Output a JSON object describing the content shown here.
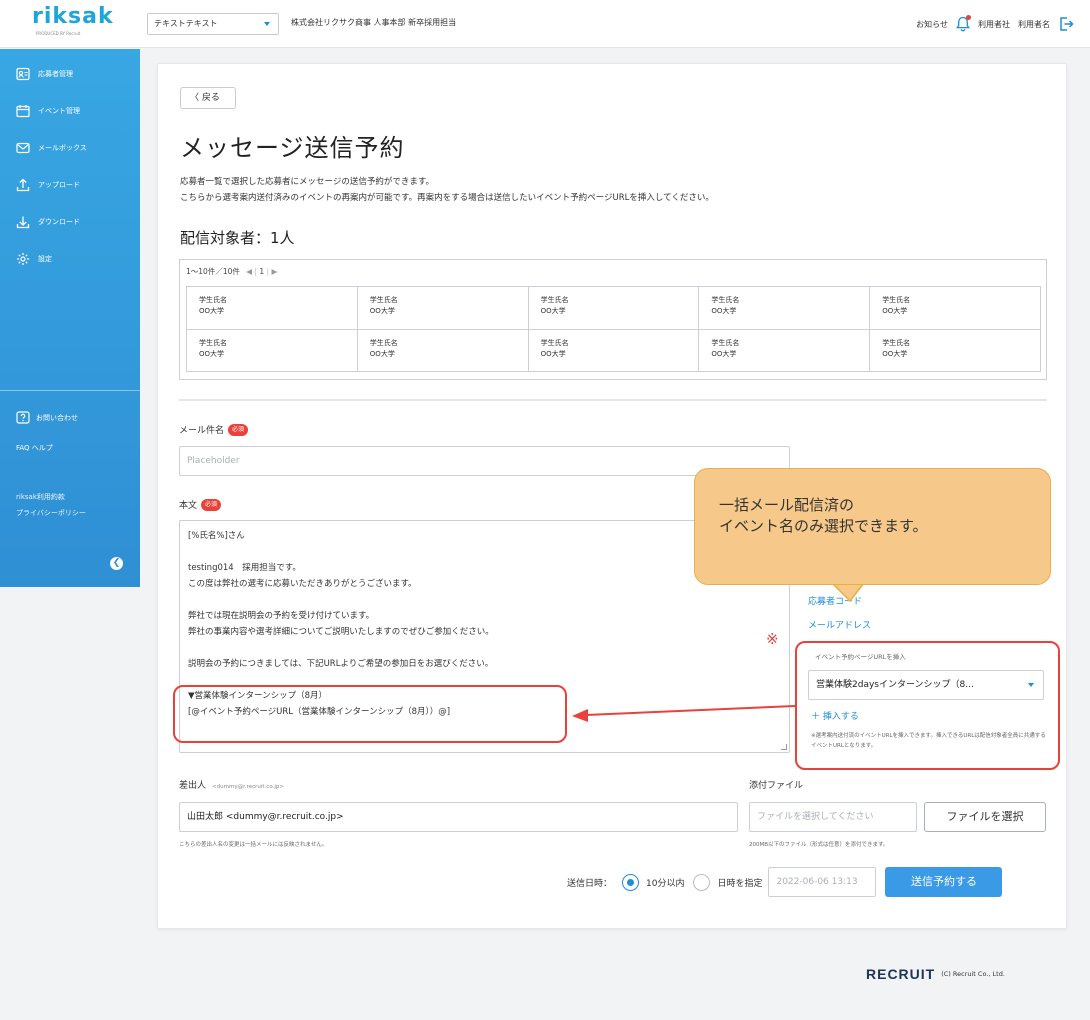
{
  "header": {
    "logo": "riksak",
    "logo_sub": "PRODUCED BY Recruit",
    "tenant": "テキストテキスト",
    "company": "株式会社リクサク商事 人事本部 新卒採用担当",
    "notice": "お知らせ",
    "company_user": "利用者社",
    "user": "利用者名"
  },
  "sidebar": {
    "items": [
      {
        "label": "応募者管理",
        "icon": "applicant-icon"
      },
      {
        "label": "イベント管理",
        "icon": "calendar-icon"
      },
      {
        "label": "メールボックス",
        "icon": "mail-icon"
      },
      {
        "label": "アップロード",
        "icon": "upload-icon"
      },
      {
        "label": "ダウンロード",
        "icon": "download-icon"
      },
      {
        "label": "設定",
        "icon": "gear-icon"
      }
    ],
    "contact": "お問い合わせ",
    "faq": "FAQ ヘルプ",
    "terms": "riksak利用約款",
    "privacy": "プライバシーポリシー"
  },
  "main": {
    "back": "戻る",
    "title": "メッセージ送信予約",
    "desc1": "応募者一覧で選択した応募者にメッセージの送信予約ができます。",
    "desc2": "こちらから選考案内送付済みのイベントの再案内が可能です。再案内をする場合は送信したいイベント予約ページURLを挿入してください。",
    "recipients": "配信対象者：1人",
    "pager": "1〜10件／10件",
    "pager_page": "1",
    "rows": [
      [
        [
          "学生氏名",
          "OO大学"
        ],
        [
          "学生氏名",
          "OO大学"
        ],
        [
          "学生氏名",
          "OO大学"
        ],
        [
          "学生氏名",
          "OO大学"
        ],
        [
          "学生氏名",
          "OO大学"
        ]
      ],
      [
        [
          "学生氏名",
          "OO大学"
        ],
        [
          "学生氏名",
          "OO大学"
        ],
        [
          "学生氏名",
          "OO大学"
        ],
        [
          "学生氏名",
          "OO大学"
        ],
        [
          "学生氏名",
          "OO大学"
        ]
      ]
    ],
    "subject_label": "メール件名",
    "required": "必須",
    "subject_placeholder": "Placeholder",
    "body_label": "本文",
    "body_lines": [
      "[%氏名%]さん",
      "",
      "testing014　採用担当です。",
      "この度は弊社の選考に応募いただきありがとうございます。",
      "",
      "弊社では現在説明会の予約を受け付けています。",
      "弊社の事業内容や選考詳細についてご説明いたしますのでぜひご参加ください。",
      "",
      "説明会の予約につきましては、下記URLよりご希望の参加日をお選びください。",
      "",
      "▼営業体験インターンシップ（8月）",
      "[@イベント予約ページURL（営業体験インターンシップ（8月））@]"
    ],
    "insert_code": "応募者コード",
    "insert_mail": "メールアドレス",
    "kome": "※",
    "event_url_label": "イベント予約ページURLを挿入",
    "event_selected": "営業体験2daysインターンシップ（8...",
    "insert_btn": "＋ 挿入する",
    "event_note": "※選考案内送付済のイベントURLを挿入できます。挿入できるURLは配信対象者全員に共通するイベントURLとなります。",
    "callout1": "一括メール配信済の",
    "callout2": "イベント名のみ選択できます。",
    "sender_label": "差出人",
    "sender_email": "<dummy@r.recruit.co.jp>",
    "sender_value": "山田太郎 <dummy@r.recruit.co.jp>",
    "sender_note": "こちらの差出人名の変更は一括メールには反映されません。",
    "attach_label": "添付ファイル",
    "attach_placeholder": "ファイルを選択してください",
    "attach_btn": "ファイルを選択",
    "attach_note": "200MB以下のファイル（形式は任意）を添付できます。",
    "send_time_label": "送信日時：",
    "opt1": "10分以内",
    "opt2": "日時を指定",
    "datetime": "2022-06-06 13:13",
    "send_btn": "送信予約する"
  },
  "footer": {
    "logo": "RECRUIT",
    "copy": "(C) Recruit Co., Ltd."
  }
}
